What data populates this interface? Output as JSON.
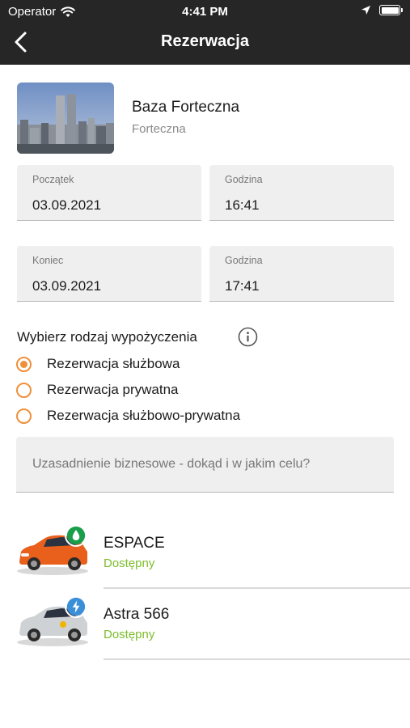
{
  "status_bar": {
    "carrier": "Operator",
    "time": "4:41 PM",
    "icons": [
      "wifi-icon",
      "location-arrow-icon",
      "battery-icon"
    ]
  },
  "nav": {
    "title": "Rezerwacja",
    "back_icon": "chevron-left-icon"
  },
  "location": {
    "name": "Baza Forteczna",
    "subtitle": "Forteczna"
  },
  "start": {
    "date_label": "Początek",
    "date_value": "03.09.2021",
    "time_label": "Godzina",
    "time_value": "16:41"
  },
  "end": {
    "date_label": "Koniec",
    "date_value": "03.09.2021",
    "time_label": "Godzina",
    "time_value": "17:41"
  },
  "rental_type": {
    "title": "Wybierz rodzaj wypożyczenia",
    "options": [
      {
        "label": "Rezerwacja służbowa",
        "selected": true
      },
      {
        "label": "Rezerwacja prywatna",
        "selected": false
      },
      {
        "label": "Rezerwacja służbowo-prywatna",
        "selected": false
      }
    ]
  },
  "justification": {
    "placeholder": "Uzasadnienie biznesowe - dokąd i w jakim celu?"
  },
  "cars": [
    {
      "name": "ESPACE",
      "status": "Dostępny",
      "badge": "fuel-drop-icon",
      "badge_color": "#1a9e4b",
      "car_color": "#e8601c"
    },
    {
      "name": "Astra 566",
      "status": "Dostępny",
      "badge": "electric-bolt-icon",
      "badge_color": "#3a8fd8",
      "car_color": "#cfd2d4"
    }
  ],
  "colors": {
    "accent": "#ef8f3a",
    "available": "#7cbd2b",
    "topbar": "#262626"
  }
}
